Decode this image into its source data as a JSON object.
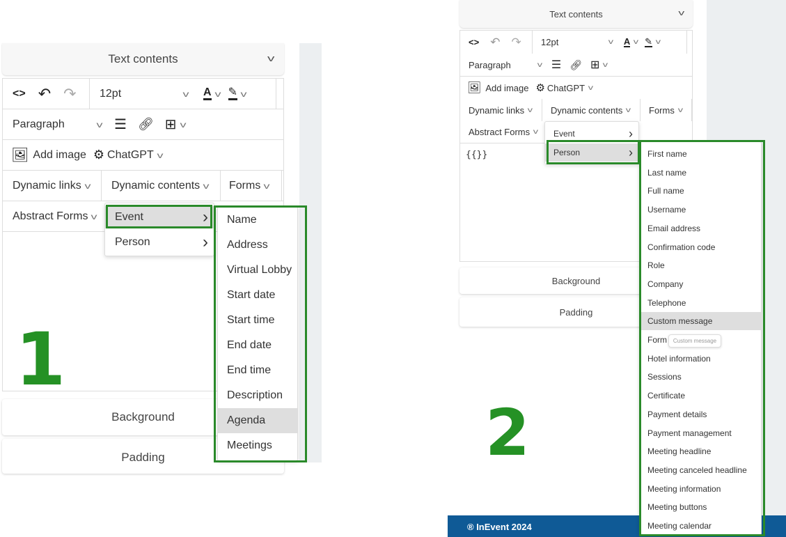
{
  "panel1": {
    "step_label": "1",
    "header": "Text contents",
    "font_size": "12pt",
    "block_format": "Paragraph",
    "add_image": "Add image",
    "chatgpt": "ChatGPT",
    "dynamic_links": "Dynamic links",
    "dynamic_contents": "Dynamic contents",
    "forms": "Forms",
    "abstract_forms": "Abstract Forms",
    "submenu": [
      {
        "label": "Event",
        "highlighted": true
      },
      {
        "label": "Person",
        "highlighted": false
      }
    ],
    "event_items": [
      "Name",
      "Address",
      "Virtual Lobby",
      "Start date",
      "Start time",
      "End date",
      "End time",
      "Description",
      "Agenda",
      "Meetings"
    ],
    "event_highlighted": "Agenda",
    "background": "Background",
    "padding": "Padding"
  },
  "panel2": {
    "step_label": "2",
    "header": "Text contents",
    "font_size": "12pt",
    "block_format": "Paragraph",
    "add_image": "Add image",
    "chatgpt": "ChatGPT",
    "dynamic_links": "Dynamic links",
    "dynamic_contents": "Dynamic contents",
    "forms": "Forms",
    "abstract_forms": "Abstract Forms",
    "editor_content": "{{}}",
    "submenu": [
      {
        "label": "Event",
        "highlighted": false
      },
      {
        "label": "Person",
        "highlighted": true
      }
    ],
    "person_items": [
      "First name",
      "Last name",
      "Full name",
      "Username",
      "Email address",
      "Confirmation code",
      "Role",
      "Company",
      "Telephone",
      "Custom message",
      "Form",
      "Hotel information",
      "Sessions",
      "Certificate",
      "Payment details",
      "Payment management",
      "Meeting headline",
      "Meeting canceled headline",
      "Meeting information",
      "Meeting buttons",
      "Meeting calendar"
    ],
    "person_highlighted": "Custom message",
    "tooltip": "Custom message",
    "background": "Background",
    "padding": "Padding",
    "footer": "® InEvent 2024"
  },
  "colors": {
    "highlight_box": "#2a8a2a",
    "step_number": "#259125",
    "footer_bg": "#0f5a96",
    "menu_hover": "#dedede"
  }
}
